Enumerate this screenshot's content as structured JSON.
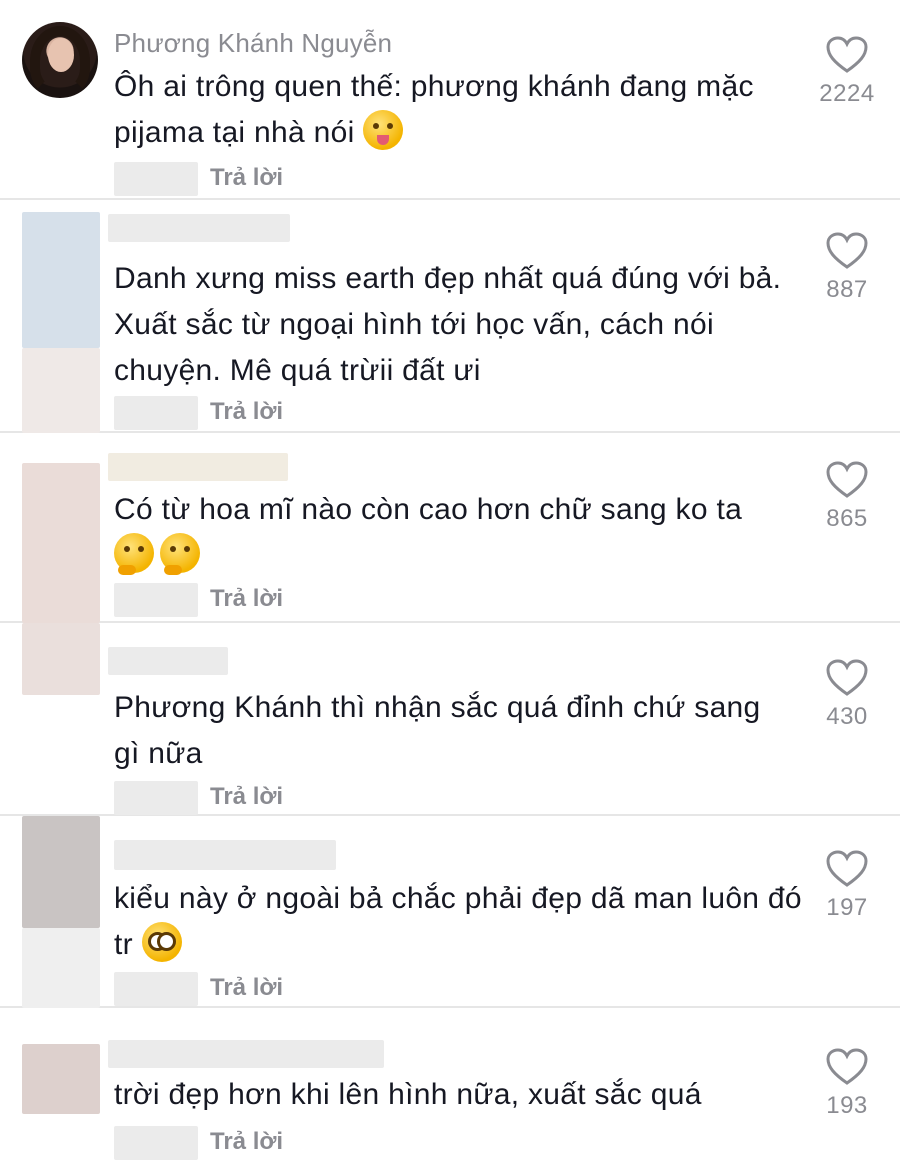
{
  "comments": [
    {
      "username": "Phương Khánh Nguyễn",
      "text": "Ôh ai trông quen thế: phương khánh đang mặc pijama tại nhà nói",
      "emoji": [
        "tongue-wink-emoji"
      ],
      "reply_label": "Trả lời",
      "likes": "2224"
    },
    {
      "username": "",
      "text": "Danh xưng miss earth đẹp nhất quá đúng với bả. Xuất sắc từ ngoại hình tới học vấn, cách nói chuyện. Mê quá trừii đất ưi",
      "emoji": [],
      "reply_label": "Trả lời",
      "likes": "887"
    },
    {
      "username": "",
      "text": "Có từ hoa mĩ nào còn cao hơn chữ sang ko ta",
      "emoji": [
        "thinking-face-emoji",
        "thinking-face-emoji"
      ],
      "reply_label": "Trả lời",
      "likes": "865"
    },
    {
      "username": "",
      "text": "Phương Khánh thì nhận sắc quá đỉnh chứ sang gì nữa",
      "emoji": [],
      "reply_label": "Trả lời",
      "likes": "430"
    },
    {
      "username": "",
      "text": "kiểu này ở ngoài bả chắc phải đẹp dã man luôn đó tr",
      "emoji": [
        "flushed-face-emoji"
      ],
      "reply_label": "Trả lời",
      "likes": "197"
    },
    {
      "username": "",
      "text": "trời đẹp hơn khi lên hình nữa, xuất sắc quá",
      "emoji": [],
      "reply_label": "Trả lời",
      "likes": "193"
    }
  ],
  "icons": {
    "like": "heart-outline-icon",
    "avatar": "user-avatar"
  },
  "colors": {
    "text": "#161823",
    "secondary": "#8a8b91",
    "divider": "#e6e6e6",
    "heart": "#8a8b91"
  }
}
